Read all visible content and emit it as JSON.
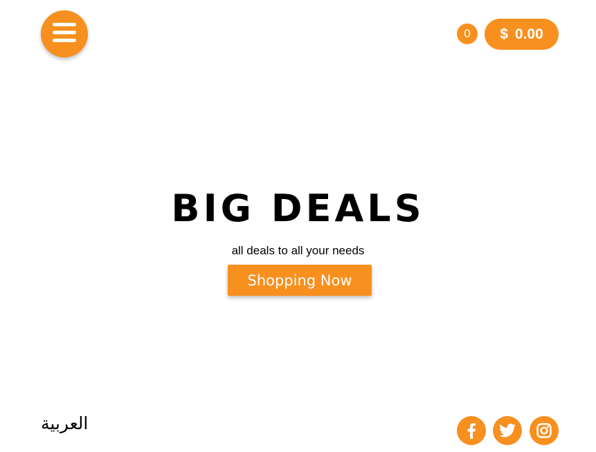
{
  "header": {
    "menu_icon": "hamburger-icon",
    "cart_count": "0",
    "cart_currency": "$",
    "cart_total": "0.00"
  },
  "hero": {
    "title": "BIG DEALS",
    "subtitle": "all deals to all your needs",
    "cta_label": "Shopping Now"
  },
  "footer": {
    "language_label": "العربية",
    "social": [
      {
        "icon": "facebook-icon"
      },
      {
        "icon": "twitter-icon"
      },
      {
        "icon": "instagram-icon"
      }
    ]
  },
  "colors": {
    "accent": "#f7901e",
    "text": "#000000",
    "background": "#ffffff"
  }
}
